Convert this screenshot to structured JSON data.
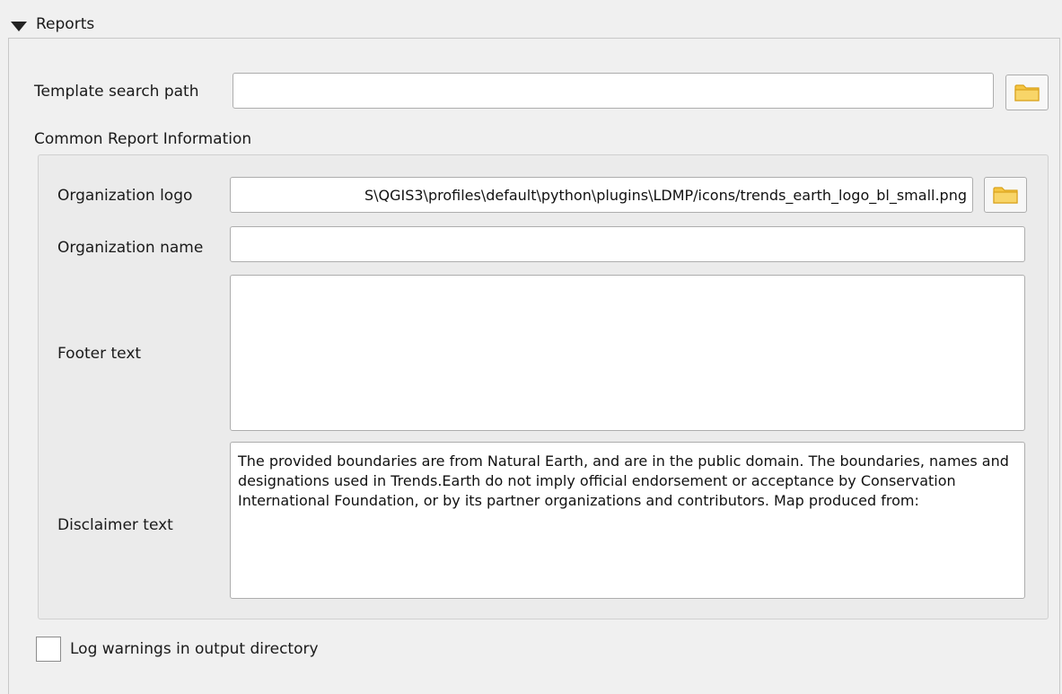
{
  "section": {
    "title": "Reports",
    "collapse_icon": "triangle-down-icon"
  },
  "template": {
    "label": "Template search path",
    "value": "",
    "browse_icon": "folder-icon"
  },
  "group": {
    "title": "Common Report Information",
    "logo_label": "Organization logo",
    "logo_value": "S\\QGIS3\\profiles\\default\\python\\plugins\\LDMP/icons/trends_earth_logo_bl_small.png",
    "logo_browse_icon": "folder-icon",
    "name_label": "Organization name",
    "name_value": "",
    "footer_label": "Footer text",
    "footer_value": "",
    "disclaimer_label": "Disclaimer text",
    "disclaimer_value": "The provided boundaries are from Natural Earth, and are in the public domain. The boundaries, names and designations used in Trends.Earth  do not imply official endorsement or acceptance by Conservation International Foundation, or by its partner organizations and contributors. Map produced from:"
  },
  "log_warnings": {
    "label": "Log warnings in output directory",
    "checked": false
  },
  "colors": {
    "folder": "#f5c542",
    "folder_dark": "#d9a21b"
  }
}
